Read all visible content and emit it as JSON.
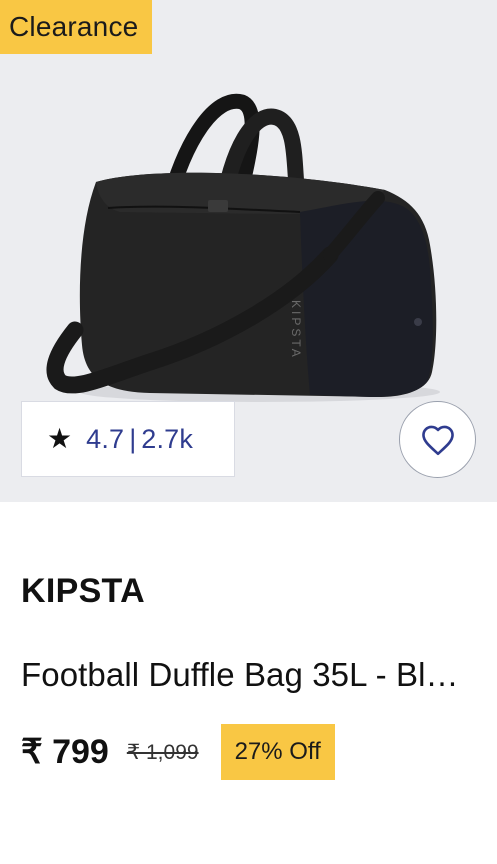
{
  "badge": {
    "label": "Clearance"
  },
  "product": {
    "brand": "KIPSTA",
    "title": "Football Duffle Bag 35L - Bl…",
    "image_label": "KIPSTA",
    "price": "₹ 799",
    "mrp": "₹ 1,099",
    "discount": "27% Off"
  },
  "rating": {
    "score": "4.7",
    "separator": "|",
    "count": "2.7k",
    "icon": "star-icon"
  },
  "wishlist": {
    "icon": "heart-icon"
  },
  "colors": {
    "badge": "#f9c744",
    "rating_text": "#2f3c8f",
    "image_bg": "#ecedf0"
  }
}
